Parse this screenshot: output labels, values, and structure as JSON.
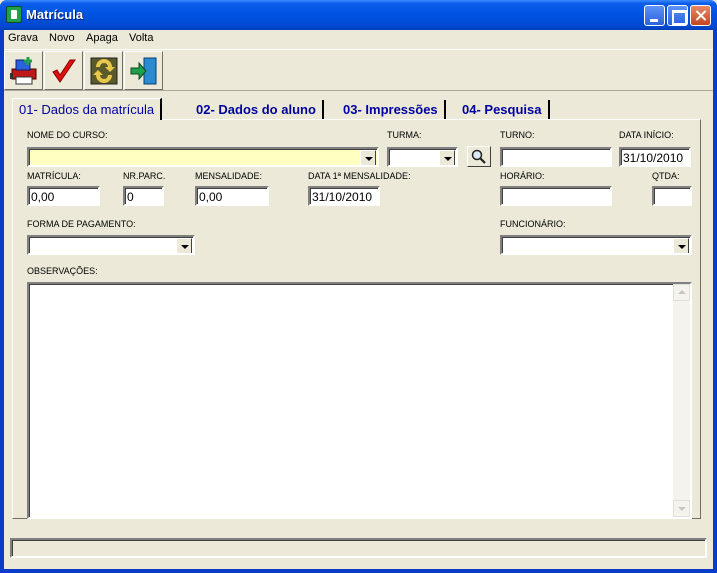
{
  "window": {
    "title": "Matrícula"
  },
  "menu": {
    "items": [
      "Grava",
      "Novo",
      "Apaga",
      "Volta"
    ]
  },
  "toolbar": {
    "buttons": [
      {
        "icon": "printer-save-icon"
      },
      {
        "icon": "checkmark-icon"
      },
      {
        "icon": "refresh-icon"
      },
      {
        "icon": "exit-door-icon"
      }
    ]
  },
  "tabs": [
    {
      "label": "01- Dados da matrícula",
      "active": true
    },
    {
      "label": "02- Dados do aluno",
      "active": false
    },
    {
      "label": "03- Impressões",
      "active": false
    },
    {
      "label": "04- Pesquisa",
      "active": false
    }
  ],
  "form": {
    "nome_curso": {
      "label": "NOME DO CURSO:",
      "value": ""
    },
    "turma": {
      "label": "TURMA:",
      "value": ""
    },
    "turno": {
      "label": "TURNO:",
      "value": ""
    },
    "data_inicio": {
      "label": "DATA INÍCIO:",
      "value": "31/10/2010"
    },
    "matricula": {
      "label": "MATRÍCULA:",
      "value": "0,00"
    },
    "nr_parc": {
      "label": "NR.PARC.",
      "value": "0"
    },
    "mensalidade": {
      "label": "MENSALIDADE:",
      "value": "0,00"
    },
    "data_primeira_mensalidade": {
      "label": "DATA 1ª MENSALIDADE:",
      "value": "31/10/2010"
    },
    "horario": {
      "label": "HORÁRIO:",
      "value": ""
    },
    "qtda": {
      "label": "QTDA:",
      "value": ""
    },
    "forma_pagamento": {
      "label": "FORMA DE PAGAMENTO:",
      "value": ""
    },
    "funcionario": {
      "label": "FUNCIONÁRIO:",
      "value": ""
    },
    "observacoes": {
      "label": "OBSERVAÇÕES:",
      "value": ""
    }
  },
  "colors": {
    "titlebar": "#0053E1",
    "highlight_field": "#FFFFC0",
    "tab_text": "#0000A0"
  }
}
